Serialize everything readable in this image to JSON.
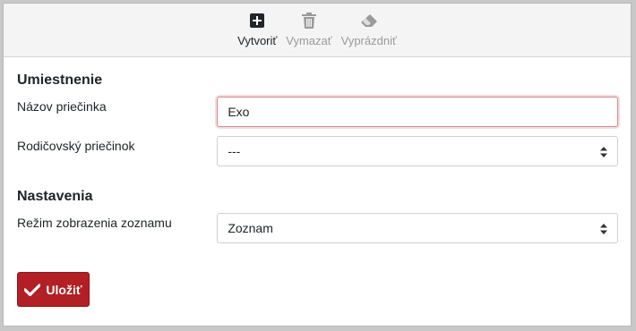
{
  "toolbar": {
    "create_label": "Vytvoriť",
    "delete_label": "Vymazať",
    "clear_label": "Vyprázdniť"
  },
  "location_section": {
    "title": "Umiestnenie",
    "folder_name_label": "Názov priečinka",
    "folder_name_value": "Exo",
    "parent_folder_label": "Rodičovský priečinok",
    "parent_folder_value": "---"
  },
  "settings_section": {
    "title": "Nastavenia",
    "list_view_mode_label": "Režim zobrazenia zoznamu",
    "list_view_mode_value": "Zoznam"
  },
  "actions": {
    "save_label": "Uložiť"
  },
  "colors": {
    "save_button": "#b21f24",
    "active_input_border": "#d28a90",
    "toolbar_background": "#f4f4f4"
  },
  "icons": {
    "create": "plus-square-icon",
    "delete": "trash-icon",
    "clear": "eraser-icon",
    "save": "checkmark-icon",
    "select": "sort-arrows-icon"
  }
}
